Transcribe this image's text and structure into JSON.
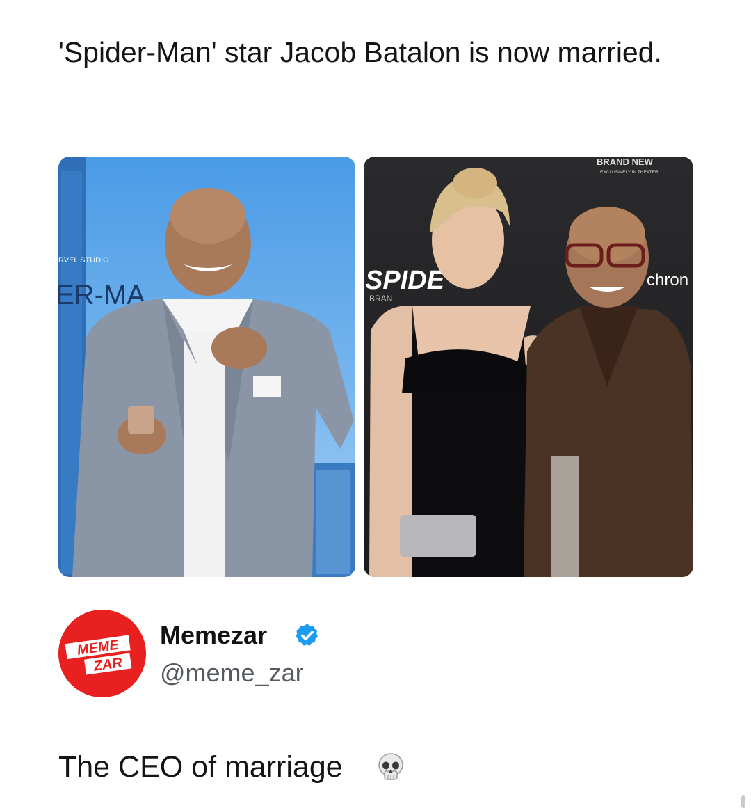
{
  "post": {
    "headline": "'Spider-Man' star Jacob Batalon is now married.",
    "caption": "The CEO of marriage",
    "caption_emoji": "skull-icon"
  },
  "photos": {
    "left": {
      "backdrop_text_1": "ER-MA",
      "backdrop_text_2": "RVEL STUDIO"
    },
    "right": {
      "backdrop_text_1": "SPIDE",
      "backdrop_text_2": "BRAN",
      "backdrop_text_3": "BRAND NEW",
      "backdrop_text_4": "EXCLUSIVELY IN THEATER",
      "backdrop_text_5": "chron"
    }
  },
  "account": {
    "display_name": "Memezar",
    "handle": "@meme_zar",
    "logo_text_top": "MEME",
    "logo_text_bottom": "ZAR",
    "verified": true
  },
  "colors": {
    "logo_red": "#e8201f",
    "verified_blue": "#1d9bf0",
    "handle_gray": "#555a60"
  }
}
